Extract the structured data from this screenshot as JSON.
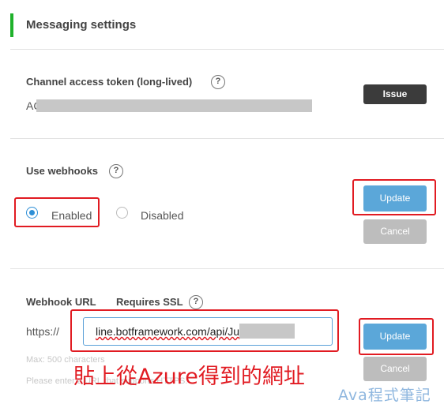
{
  "section": {
    "title": "Messaging settings"
  },
  "channel_token": {
    "label": "Channel access token (long-lived)",
    "value_prefix": "AC",
    "issue_button": "Issue"
  },
  "webhooks": {
    "label": "Use webhooks",
    "enabled_label": "Enabled",
    "disabled_label": "Disabled",
    "selected": "Enabled",
    "update_button": "Update",
    "cancel_button": "Cancel"
  },
  "webhook_url": {
    "label": "Webhook URL",
    "ssl_label": "Requires SSL",
    "prefix": "https://",
    "value": "line.botframework.com/api/Ju",
    "max_hint": "Max: 500 characters",
    "https_hint": "Please enter a URL that supports HTTPS.",
    "update_button": "Update",
    "cancel_button": "Cancel"
  },
  "annotation": "貼上從Azure得到的網址",
  "watermark": "Ava程式筆記",
  "help_glyph": "?",
  "colors": {
    "accent_green": "#1fb12b",
    "highlight_red": "#e11b22",
    "update_blue": "#5ba7d9",
    "issue_dark": "#3b3b3b",
    "cancel_gray": "#bdbdbd"
  }
}
